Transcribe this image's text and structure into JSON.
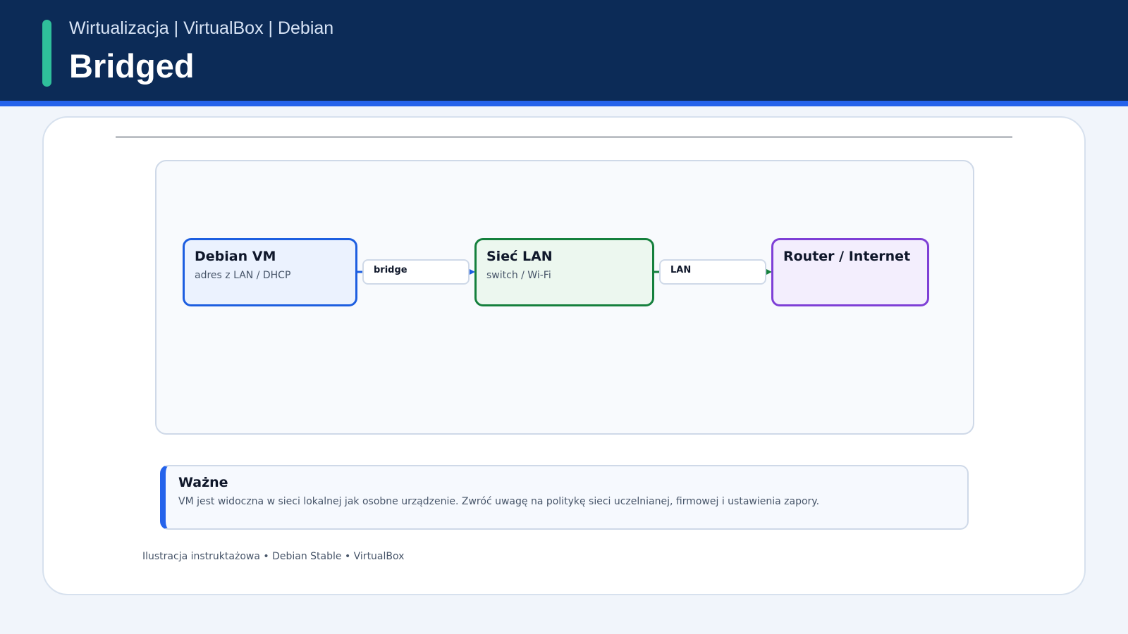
{
  "header": {
    "kicker": "Wirtualizacja | VirtualBox | Debian",
    "title": "Bridged"
  },
  "diagram": {
    "nodes": [
      {
        "id": "vm",
        "title": "Debian VM",
        "subtitle": "adres z LAN / DHCP",
        "color": "#1d5ee0"
      },
      {
        "id": "lan",
        "title": "Sieć LAN",
        "subtitle": "switch / Wi-Fi",
        "color": "#15803d"
      },
      {
        "id": "router",
        "title": "Router / Internet",
        "subtitle": "",
        "color": "#7e3fd6"
      }
    ],
    "edges": [
      {
        "from": "vm",
        "to": "lan",
        "label": "bridge",
        "color": "#1d5ee0"
      },
      {
        "from": "lan",
        "to": "router",
        "label": "LAN",
        "color": "#15803d"
      }
    ]
  },
  "note": {
    "title": "Ważne",
    "body": "VM jest widoczna w sieci lokalnej jak osobne urządzenie. Zwróć uwagę na politykę sieci uczelnianej, firmowej i ustawienia zapory."
  },
  "footer": {
    "text": "Ilustracja instruktażowa • Debian Stable • VirtualBox"
  },
  "colors": {
    "header_bg": "#0c2b57",
    "header_stripe": "#2563eb",
    "accent": "#2fbf9b"
  }
}
